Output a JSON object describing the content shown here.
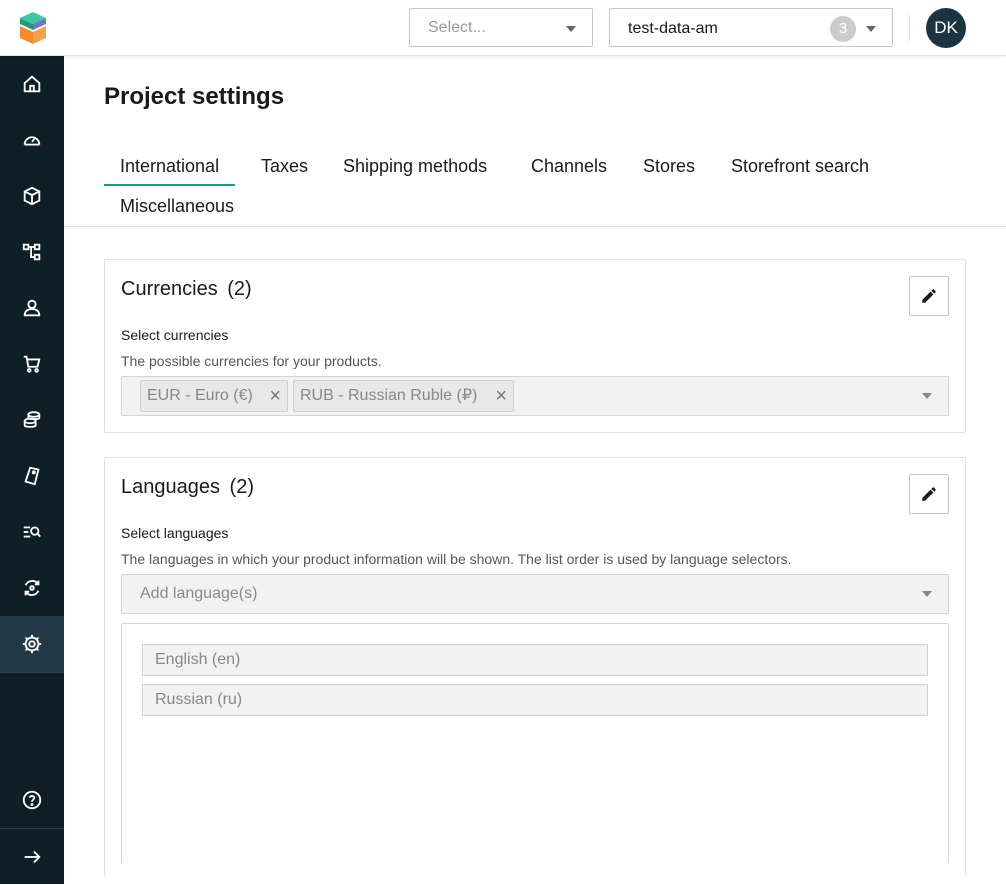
{
  "colors": {
    "accent": "#0e9e8d",
    "sidebar_bg": "#0f1e27",
    "sidebar_active": "#213a46",
    "avatar_bg": "#1a3540"
  },
  "header": {
    "logo_icon": "merchant-center-logo-icon",
    "project_select": {
      "placeholder": "Select..."
    },
    "environment_select": {
      "value": "test-data-am",
      "badge_count": "3"
    },
    "user_avatar": {
      "initials": "DK"
    }
  },
  "sidebar": {
    "items": [
      {
        "icon": "home-icon"
      },
      {
        "icon": "dashboard-gauge-icon"
      },
      {
        "icon": "box-icon"
      },
      {
        "icon": "tree-structure-icon"
      },
      {
        "icon": "user-icon"
      },
      {
        "icon": "cart-icon"
      },
      {
        "icon": "coins-stack-icon"
      },
      {
        "icon": "discount-tag-icon"
      },
      {
        "icon": "list-search-icon"
      },
      {
        "icon": "sync-icon"
      },
      {
        "icon": "gear-icon",
        "active": true
      },
      {
        "icon": "help-icon"
      },
      {
        "icon": "arrow-right-icon"
      }
    ]
  },
  "page": {
    "title": "Project settings",
    "tabs": [
      {
        "label": "International",
        "active": true
      },
      {
        "label": "Taxes"
      },
      {
        "label": "Shipping methods"
      },
      {
        "label": "Channels"
      },
      {
        "label": "Stores"
      },
      {
        "label": "Storefront search"
      },
      {
        "label": "Miscellaneous"
      }
    ]
  },
  "currencies": {
    "title": "Currencies",
    "count": "(2)",
    "field_label": "Select currencies",
    "description": "The possible currencies for your products.",
    "chips": [
      "EUR - Euro (€)",
      "RUB - Russian Ruble (₽)"
    ]
  },
  "languages": {
    "title": "Languages",
    "count": "(2)",
    "field_label": "Select languages",
    "description": "The languages in which your product information will be shown.  The list order is used by language selectors.",
    "placeholder": "Add language(s)",
    "items": [
      "English (en)",
      "Russian (ru)"
    ]
  }
}
